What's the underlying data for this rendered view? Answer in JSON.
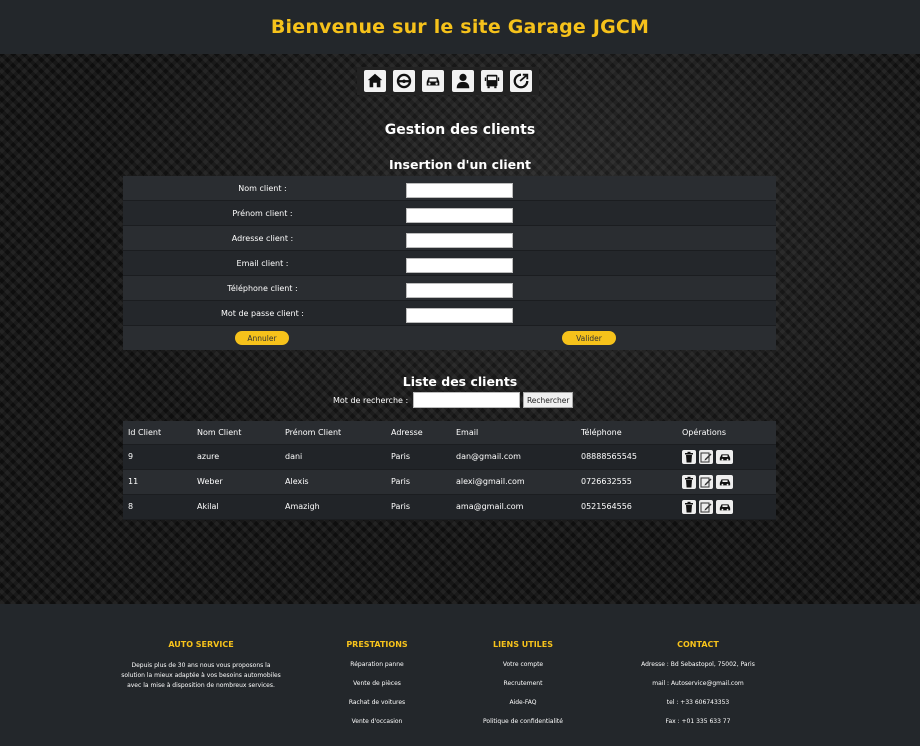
{
  "header": {
    "title": "Bienvenue sur le site Garage JGCM"
  },
  "nav": {
    "icons": [
      "home-icon",
      "steering-wheel-icon",
      "car-icon",
      "mechanic-icon",
      "bus-icon",
      "logout-icon"
    ]
  },
  "page_title": "Gestion des clients",
  "form": {
    "title": "Insertion d'un client",
    "fields": [
      {
        "label": "Nom client :",
        "value": ""
      },
      {
        "label": "Prénom client :",
        "value": ""
      },
      {
        "label": "Adresse client :",
        "value": ""
      },
      {
        "label": "Email client :",
        "value": ""
      },
      {
        "label": "Téléphone client :",
        "value": ""
      },
      {
        "label": "Mot de passe client :",
        "value": ""
      }
    ],
    "cancel_label": "Annuler",
    "submit_label": "Valider"
  },
  "list": {
    "title": "Liste des clients",
    "search_label": "Mot de recherche :",
    "search_value": "",
    "search_button": "Rechercher",
    "columns": [
      "Id Client",
      "Nom Client",
      "Prénom Client",
      "Adresse",
      "Email",
      "Téléphone",
      "Opérations"
    ],
    "rows": [
      [
        "9",
        "azure",
        "dani",
        "Paris",
        "dan@gmail.com",
        "08888565545"
      ],
      [
        "11",
        "Weber",
        "Alexis",
        "Paris",
        "alexi@gmail.com",
        "0726632555"
      ],
      [
        "8",
        "Akilal",
        "Amazigh",
        "Paris",
        "ama@gmail.com",
        "0521564556"
      ]
    ],
    "row_operations": [
      "trash-icon",
      "edit-icon",
      "car-icon"
    ]
  },
  "footer": {
    "auto_service": {
      "title": "AUTO SERVICE",
      "lines": [
        "Depuis plus de 30 ans nous vous proposons la",
        "solution la mieux adaptée à vos besoins automobiles",
        "avec la mise à disposition de nombreux services."
      ]
    },
    "prestations": {
      "title": "PRESTATIONS",
      "links": [
        "Réparation panne",
        "Vente de pièces",
        "Rachat de voitures",
        "Vente d'occasion"
      ]
    },
    "liens_utiles": {
      "title": "LIENS UTILES",
      "links": [
        "Votre compte",
        "Recrutement",
        "Aide-FAQ",
        "Politique de confidentialité"
      ]
    },
    "contact": {
      "title": "CONTACT",
      "lines": [
        "Adresse : Bd Sebastopol, 75002, Paris",
        "mail : Autoservice@gmail.com",
        "tel : +33 606743353",
        "Fax : +01 335 633 77"
      ]
    }
  },
  "colors": {
    "accent": "#f6c21b",
    "header_bg": "#23272b",
    "row_dark": "#212428",
    "row_light": "#2a2d31"
  }
}
